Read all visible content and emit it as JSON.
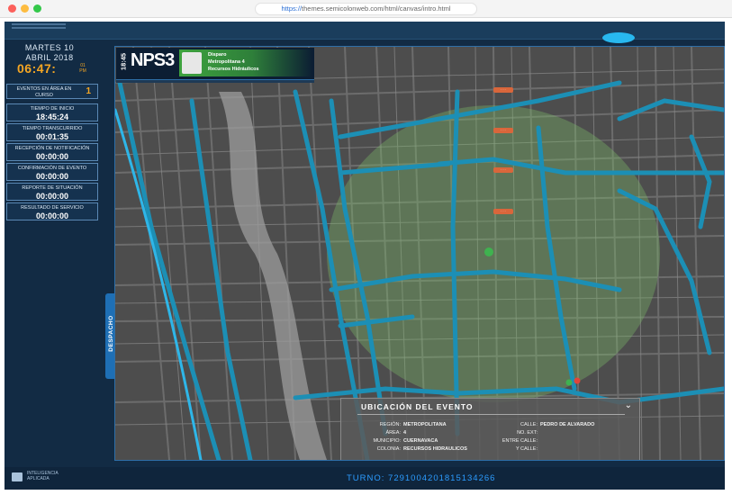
{
  "browser": {
    "url_protocol": "https://",
    "url_rest": "themes.semicolonweb.com/html/canvas/intro.html"
  },
  "sidebar": {
    "date_line1": "MARTES 10",
    "date_line2": "ABRIL 2018",
    "clock": "06:47:",
    "clock_ampm": "01 PM",
    "events_label": "EVENTOS EN ÁREA EN CURSO",
    "events_count": "1",
    "stats": [
      {
        "label": "TIEMPO DE INICIO",
        "value": "18:45:24"
      },
      {
        "label": "TIEMPO TRANSCURRIDO",
        "value": "00:01:35"
      },
      {
        "label": "RECEPCIÓN DE NOTIFICACIÓN",
        "value": "00:00:00"
      },
      {
        "label": "CONFIRMACIÓN DE EVENTO",
        "value": "00:00:00"
      },
      {
        "label": "REPORTE DE SITUACIÓN",
        "value": "00:00:00"
      },
      {
        "label": "RESULTADO DE SERVICIO",
        "value": "00:00:00"
      }
    ]
  },
  "despacho_tab": "DESPACHO",
  "event_header": {
    "time": "18:45",
    "code": "NPS3",
    "line1": "Disparo",
    "line2": "Metropolitana 4",
    "line3": "Recursos Hidráulicos"
  },
  "ubicacion": {
    "title": "UBICACIÓN DEL EVENTO",
    "region_key": "REGIÓN:",
    "region_val": "METROPOLITANA",
    "area_key": "ÁREA:",
    "area_val": "4",
    "municipio_key": "MUNICIPIO:",
    "municipio_val": "CUERNAVACA",
    "colonia_key": "COLONIA:",
    "colonia_val": "RECURSOS HIDRAULICOS",
    "calle_key": "CALLE:",
    "calle_val": "PEDRO DE ALVARADO",
    "noext_key": "NO. EXT:",
    "noext_val": "",
    "entre_key": "ENTRE CALLE:",
    "entre_val": "",
    "ycalle_key": "Y CALLE:",
    "ycalle_val": ""
  },
  "bottom": {
    "logo_text": "INTELIGENCIA APLICADA",
    "turno": "TURNO: 72910042018151342​66"
  },
  "colors": {
    "accent_orange": "#f5a623",
    "road_blue": "#1c8fb5",
    "zone_green": "#7fbf6a",
    "panel_bg": "#122b44"
  }
}
